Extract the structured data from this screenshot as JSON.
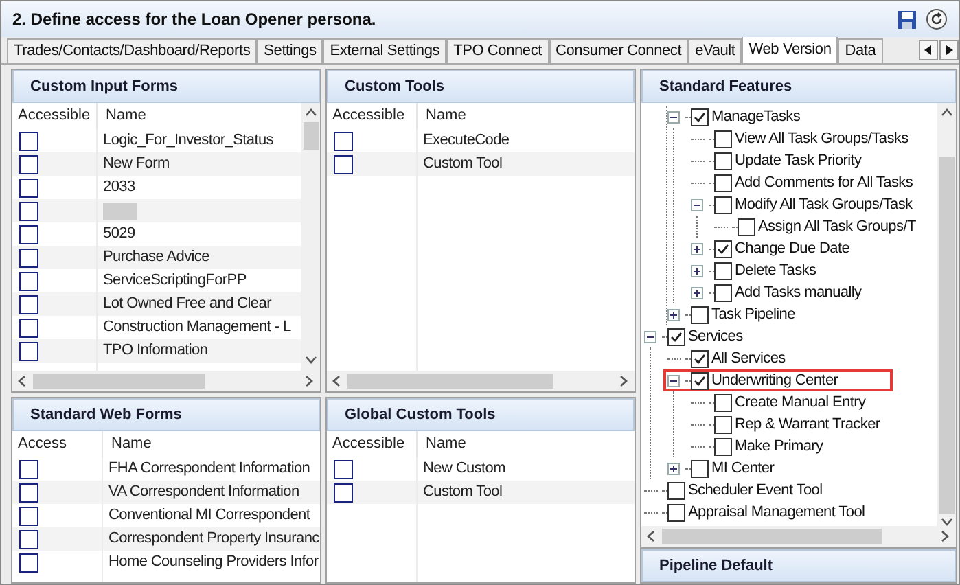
{
  "window": {
    "title": "2. Define access for the Loan Opener persona."
  },
  "tabs": [
    {
      "label": "Trades/Contacts/Dashboard/Reports",
      "selected": false
    },
    {
      "label": "Settings",
      "selected": false
    },
    {
      "label": "External Settings",
      "selected": false
    },
    {
      "label": "TPO Connect",
      "selected": false
    },
    {
      "label": "Consumer Connect",
      "selected": false
    },
    {
      "label": "eVault",
      "selected": false
    },
    {
      "label": "Web Version",
      "selected": true
    },
    {
      "label": "Data",
      "selected": false
    }
  ],
  "custom_input_forms": {
    "title": "Custom Input Forms",
    "columns": [
      "Accessible",
      "Name"
    ],
    "rows": [
      {
        "kind": "text",
        "checked": false,
        "name": "Logic_For_Investor_Status"
      },
      {
        "kind": "text",
        "checked": false,
        "name": "New Form"
      },
      {
        "kind": "text",
        "checked": false,
        "name": "2033"
      },
      {
        "kind": "redacted",
        "checked": false
      },
      {
        "kind": "text",
        "checked": false,
        "name": "5029"
      },
      {
        "kind": "text",
        "checked": false,
        "name": "Purchase Advice"
      },
      {
        "kind": "text",
        "checked": false,
        "name": "ServiceScriptingForPP"
      },
      {
        "kind": "text",
        "checked": false,
        "name": "Lot Owned Free and Clear"
      },
      {
        "kind": "text",
        "checked": false,
        "name": "Construction Management - L"
      },
      {
        "kind": "text",
        "checked": false,
        "name": "TPO Information"
      }
    ]
  },
  "custom_tools": {
    "title": "Custom Tools",
    "columns": [
      "Accessible",
      "Name"
    ],
    "rows": [
      {
        "kind": "text",
        "checked": false,
        "name": "ExecuteCode"
      },
      {
        "kind": "text",
        "checked": false,
        "name": "Custom Tool"
      }
    ]
  },
  "standard_web_forms": {
    "title": "Standard Web Forms",
    "columns": [
      "Access",
      "Name"
    ],
    "rows": [
      {
        "kind": "text",
        "checked": false,
        "name": "FHA Correspondent Information"
      },
      {
        "kind": "text",
        "checked": false,
        "name": "VA Correspondent Information"
      },
      {
        "kind": "text",
        "checked": false,
        "name": "Conventional MI Correspondent"
      },
      {
        "kind": "text",
        "checked": false,
        "name": "Correspondent Property Insuranc"
      },
      {
        "kind": "text",
        "checked": false,
        "name": "Home Counseling Providers Infor"
      }
    ]
  },
  "global_custom_tools": {
    "title": "Global Custom Tools",
    "columns": [
      "Accessible",
      "Name"
    ],
    "rows": [
      {
        "kind": "text",
        "checked": false,
        "name": "New Custom"
      },
      {
        "kind": "text",
        "checked": false,
        "name": "Custom Tool"
      }
    ]
  },
  "standard_features": {
    "title": "Standard Features",
    "tree": [
      {
        "children": [
          {
            "label": "ManageTasks",
            "checked": true,
            "expanded": true,
            "highlighted": false,
            "children": [
              {
                "label": "View All Task Groups/Tasks",
                "checked": false,
                "highlighted": false
              },
              {
                "label": "Update Task Priority",
                "checked": false,
                "highlighted": false
              },
              {
                "label": "Add Comments for All Tasks",
                "checked": false,
                "highlighted": false
              },
              {
                "label": "Modify All Task Groups/Task",
                "checked": false,
                "expanded": true,
                "highlighted": false,
                "children": [
                  {
                    "label": "Assign All Task Groups/T",
                    "checked": false,
                    "highlighted": false
                  }
                ]
              },
              {
                "label": "Change Due Date",
                "checked": true,
                "expanded": false,
                "highlighted": false
              },
              {
                "label": "Delete Tasks",
                "checked": false,
                "expanded": false,
                "highlighted": false
              },
              {
                "label": "Add Tasks manually",
                "checked": false,
                "expanded": false,
                "highlighted": false
              }
            ]
          },
          {
            "label": "Task Pipeline",
            "checked": false,
            "expanded": false,
            "highlighted": false
          }
        ]
      },
      {
        "label": "Services",
        "checked": true,
        "expanded": true,
        "highlighted": false,
        "children": [
          {
            "label": "All Services",
            "checked": true,
            "highlighted": false
          },
          {
            "label": "Underwriting Center",
            "checked": true,
            "expanded": true,
            "highlighted": true,
            "children": [
              {
                "label": "Create Manual Entry",
                "checked": false,
                "highlighted": false
              },
              {
                "label": "Rep & Warrant Tracker",
                "checked": false,
                "highlighted": false
              },
              {
                "label": "Make Primary",
                "checked": false,
                "highlighted": false
              }
            ]
          },
          {
            "label": "MI Center",
            "checked": false,
            "expanded": false,
            "highlighted": false
          }
        ]
      },
      {
        "label": "Scheduler Event Tool",
        "checked": false,
        "highlighted": false
      },
      {
        "label": "Appraisal Management Tool",
        "checked": false,
        "highlighted": false
      }
    ]
  },
  "pipeline_default": {
    "title": "Pipeline Default"
  }
}
